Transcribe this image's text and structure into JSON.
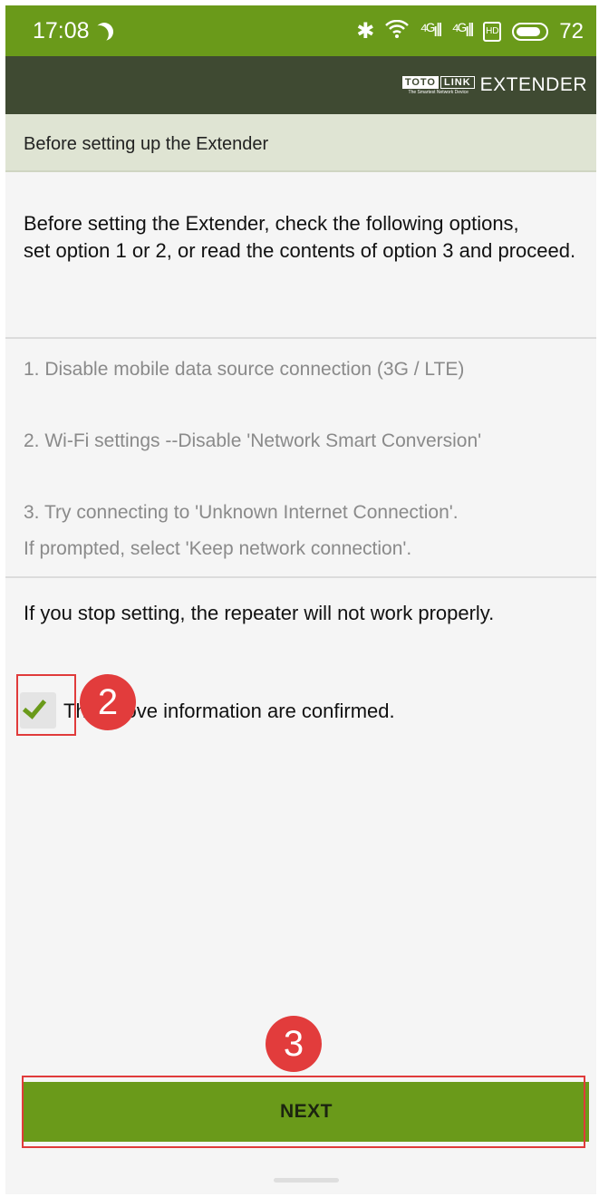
{
  "status_bar": {
    "time": "17:08",
    "signal1": "⁴ᴳıll",
    "signal2": "⁴ᴳıll",
    "sim_label": "HD",
    "battery": "72"
  },
  "app_bar": {
    "logo_toto": "TOTO",
    "logo_link": "LINK",
    "logo_tagline": "The Smartest Network Device",
    "title": "EXTENDER"
  },
  "section": {
    "title": "Before setting up the Extender"
  },
  "intro": {
    "line1": "Before setting the Extender, check the following options,",
    "line2": "set option 1 or 2, or read the contents of option 3 and proceed."
  },
  "options": [
    {
      "text": "1. Disable mobile data source connection (3G / LTE)"
    },
    {
      "text": "2. Wi-Fi settings --Disable 'Network Smart Conversion'"
    },
    {
      "text": "3. Try connecting to 'Unknown Internet Connection'."
    },
    {
      "text": "If prompted, select 'Keep network connection'."
    }
  ],
  "warning": "If you stop setting, the repeater will not work properly.",
  "confirm": {
    "label": "The above information are confirmed.",
    "checked": true
  },
  "annotations": [
    {
      "label": "2"
    },
    {
      "label": "3"
    }
  ],
  "next_button": "NEXT",
  "colors": {
    "accent": "#6a9a1a",
    "appbar": "#3f4a32",
    "section_bg": "#dfe4d3",
    "annotation": "#e23c3c"
  }
}
